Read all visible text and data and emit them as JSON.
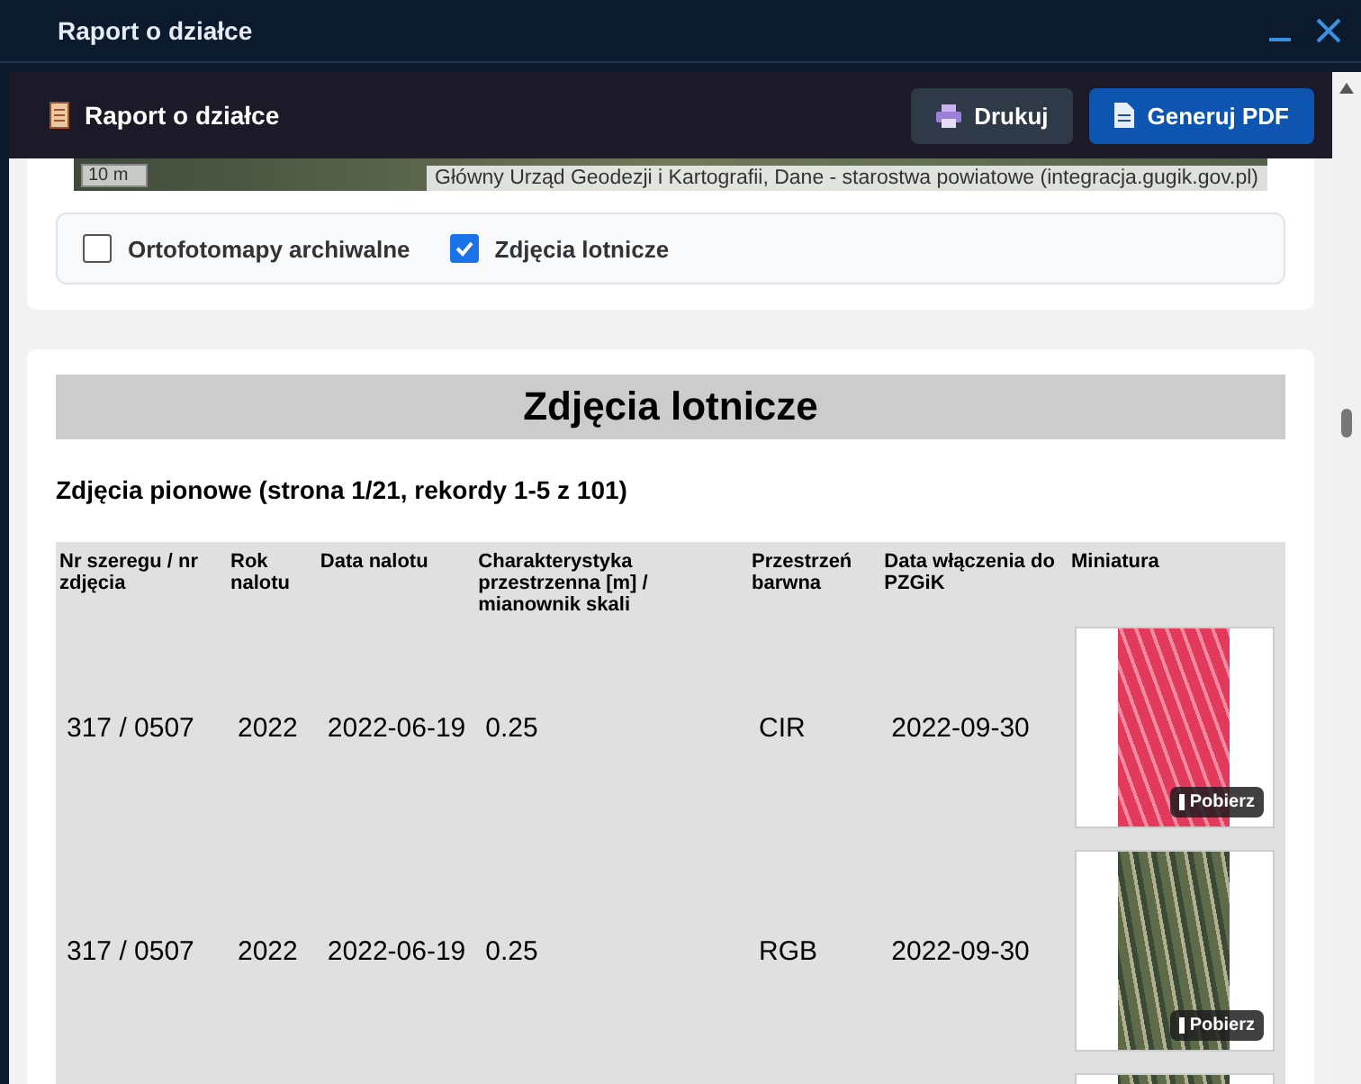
{
  "window": {
    "title": "Raport o działce"
  },
  "report_header": {
    "title": "Raport o działce",
    "buttons": [
      {
        "label": "Drukuj",
        "kind": "print"
      },
      {
        "label": "Generuj PDF",
        "kind": "pdf"
      }
    ]
  },
  "map": {
    "scale": "10 m",
    "attribution": "Główny Urząd Geodezji i Kartografii, Dane - starostwa powiatowe (integracja.gugik.gov.pl)"
  },
  "layers": [
    {
      "label": "Ortofotomapy archiwalne",
      "checked": false
    },
    {
      "label": "Zdjęcia lotnicze",
      "checked": true
    }
  ],
  "section": {
    "title": "Zdjęcia lotnicze",
    "subtitle": "Zdjęcia pionowe (strona 1/21, rekordy 1-5 z 101)"
  },
  "table": {
    "columns": [
      "Nr szeregu / nr zdjęcia",
      "Rok nalotu",
      "Data nalotu",
      "Charakterystyka przestrzenna [m] / mianownik skali",
      "Przestrzeń barwna",
      "Data włączenia do PZGiK",
      "Miniatura"
    ],
    "rows": [
      {
        "cells": [
          "317 / 0507",
          "2022",
          "2022-06-19",
          "0.25",
          "CIR",
          "2022-09-30"
        ],
        "thumbnail": {
          "kind": "cir",
          "button": "Pobierz"
        }
      },
      {
        "cells": [
          "317 / 0507",
          "2022",
          "2022-06-19",
          "0.25",
          "RGB",
          "2022-09-30"
        ],
        "thumbnail": {
          "kind": "rgb",
          "button": "Pobierz"
        }
      },
      {
        "cells": [],
        "thumbnail": {
          "kind": "rgb"
        }
      }
    ]
  }
}
